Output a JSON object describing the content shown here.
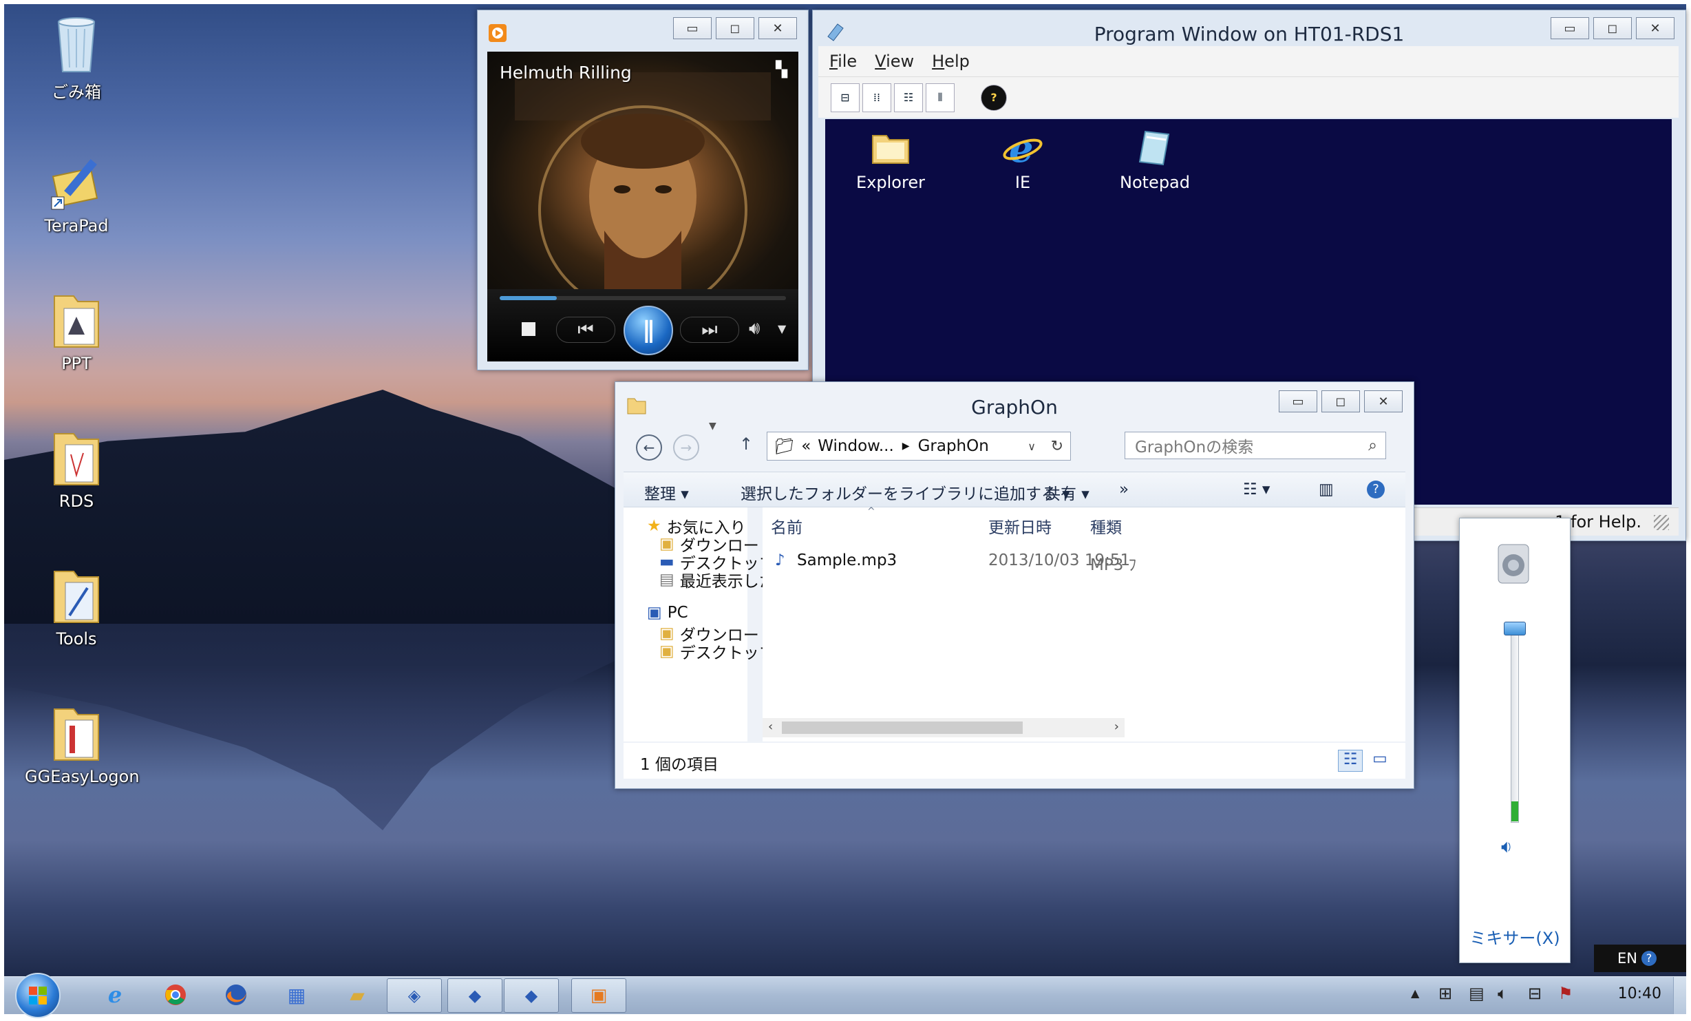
{
  "desktop": {
    "icons": [
      {
        "label": "ごみ箱"
      },
      {
        "label": "TeraPad"
      },
      {
        "label": "PPT"
      },
      {
        "label": "RDS"
      },
      {
        "label": "Tools"
      },
      {
        "label": "GGEasyLogon"
      }
    ]
  },
  "media_player": {
    "artist": "Helmuth Rilling",
    "progress": 0.2
  },
  "program_window": {
    "title": "Program Window on HT01-RDS1",
    "menu": [
      "File",
      "View",
      "Help"
    ],
    "programs": [
      {
        "label": "Explorer"
      },
      {
        "label": "IE"
      },
      {
        "label": "Notepad"
      }
    ],
    "status": "1 for Help."
  },
  "explorer": {
    "title": "GraphOn",
    "breadcrumb_prefix": "«",
    "breadcrumb": [
      "Window...",
      "GraphOn"
    ],
    "search_placeholder": "GraphOnの検索",
    "commands": {
      "organize": "整理",
      "add_to_library": "選択したフォルダーをライブラリに追加する",
      "share": "共有",
      "more": "»"
    },
    "nav": {
      "favorites": "お気に入り",
      "downloads": "ダウンロード",
      "desktop": "デスクトップ",
      "recent": "最近表示した場所",
      "pc": "PC",
      "pc_downloads": "ダウンロード",
      "pc_desktop": "デスクトップ"
    },
    "columns": {
      "name": "名前",
      "modified": "更新日時",
      "type": "種類"
    },
    "files": [
      {
        "name": "Sample.mp3",
        "modified": "2013/10/03 19:51",
        "type": "MP3 ﾌ"
      }
    ],
    "status": "1 個の項目"
  },
  "volume": {
    "mixer_label": "ミキサー(X)",
    "level": 0.1
  },
  "tray": {
    "language": "EN",
    "clock": "10:40"
  }
}
